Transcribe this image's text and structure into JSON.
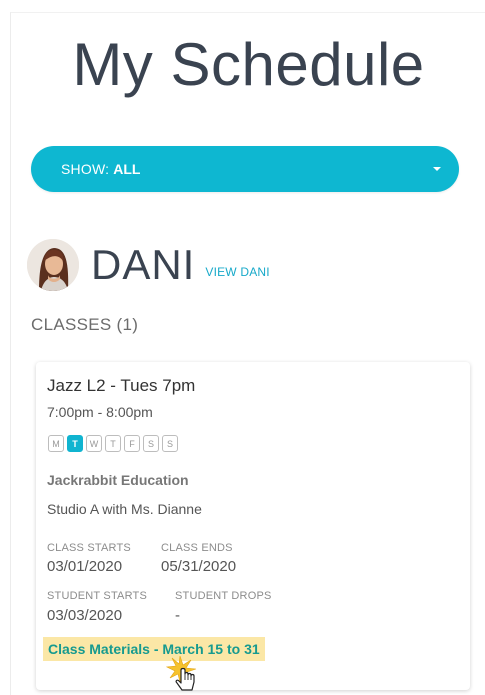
{
  "page": {
    "title": "My Schedule"
  },
  "filter": {
    "label": "SHOW:",
    "value": "ALL"
  },
  "student": {
    "name": "DANI",
    "view_link": "VIEW DANI"
  },
  "classes": {
    "heading": "CLASSES (1)",
    "items": [
      {
        "name": "Jazz L2 - Tues 7pm",
        "time": "7:00pm - 8:00pm",
        "days": [
          {
            "letter": "M",
            "active": false
          },
          {
            "letter": "T",
            "active": true
          },
          {
            "letter": "W",
            "active": false
          },
          {
            "letter": "T",
            "active": false
          },
          {
            "letter": "F",
            "active": false
          },
          {
            "letter": "S",
            "active": false
          },
          {
            "letter": "S",
            "active": false
          }
        ],
        "organization": "Jackrabbit Education",
        "location": "Studio A with Ms. Dianne",
        "class_starts_label": "CLASS STARTS",
        "class_starts": "03/01/2020",
        "class_ends_label": "CLASS ENDS",
        "class_ends": "05/31/2020",
        "student_starts_label": "STUDENT STARTS",
        "student_starts": "03/03/2020",
        "student_drops_label": "STUDENT DROPS",
        "student_drops": "-",
        "materials_link": "Class Materials - March 15 to 31"
      }
    ]
  },
  "colors": {
    "accent": "#0eb7d1",
    "link": "#17a9c9",
    "materials_text": "#169a8f",
    "highlight": "#fbe7a6"
  }
}
